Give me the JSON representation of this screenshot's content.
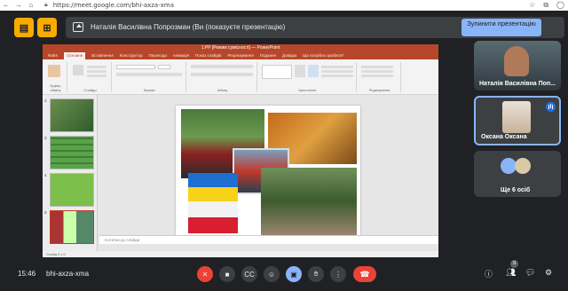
{
  "browser": {
    "url": "https://meet.google.com/bhi-axza-xma"
  },
  "banner": {
    "presenter_text": "Наталія Василівна Попрозман (Ви (показуєте презентацію)",
    "stop_label": "Зупинити презентацію"
  },
  "presentation": {
    "window_title": "1.PP [Режим сумісності] — PowerPoint",
    "tabs": [
      "Файл",
      "Основне",
      "Вставлення",
      "Конструктор",
      "Переходи",
      "Анімація",
      "Показ слайдів",
      "Рецензування",
      "Подання",
      "Довідка",
      "Що потрібно зробити?"
    ],
    "active_tab": "Основне",
    "ribbon_groups": [
      "Буфер обміну",
      "Слайди",
      "Шрифт",
      "Абзац",
      "Креслення",
      "Редагування"
    ],
    "thumb_numbers": [
      "2",
      "3",
      "4",
      "5"
    ],
    "notes_placeholder": "Нотатки до слайда",
    "status_text": "Слайд 5 з 5"
  },
  "participants": [
    {
      "name": "Наталія Василівна Поп..."
    },
    {
      "name": "Оксана Оксана"
    },
    {
      "name": "Ще 6 осіб"
    }
  ],
  "meeting": {
    "time": "15:46",
    "code": "bhi-axza-xma",
    "people_count": "9"
  }
}
